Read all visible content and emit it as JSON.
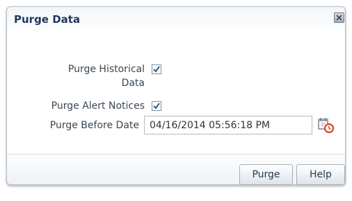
{
  "dialog": {
    "title": "Purge Data",
    "close_icon": "close-icon"
  },
  "form": {
    "purge_historical_label_line1": "Purge Historical",
    "purge_historical_label_line2": "Data",
    "purge_historical_checked": true,
    "purge_alert_label": "Purge Alert Notices",
    "purge_alert_checked": true,
    "purge_before_label": "Purge Before Date",
    "purge_before_value": "04/16/2014 05:56:18 PM",
    "calendar_icon": "calendar-clock-icon"
  },
  "buttons": {
    "purge_label": "Purge",
    "help_label": "Help"
  },
  "colors": {
    "title_text": "#1d3a5c",
    "label_text": "#3a4753",
    "checkmark": "#2b5a8e",
    "clock_accent": "#d9381e"
  }
}
